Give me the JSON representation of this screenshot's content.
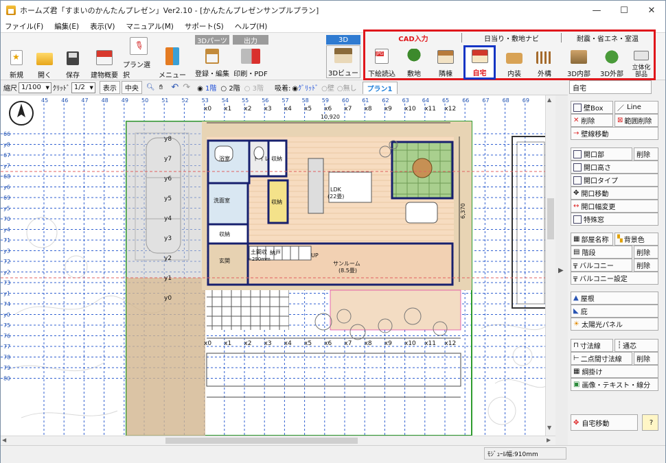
{
  "window": {
    "title": "ホームズ君「すまいのかんたんプレゼン」Ver2.10 - [かんたんプレゼンサンプルプラン]"
  },
  "menu": [
    "ファイル(F)",
    "編集(E)",
    "表示(V)",
    "マニュアル(M)",
    "サポート(S)",
    "ヘルプ(H)"
  ],
  "toolbar": {
    "new": "新規",
    "open": "開く",
    "save": "保存",
    "overview": "建物概要",
    "plan_select": "プラン選択",
    "menu": "メニュー",
    "parts3d_header": "3Dパーツ",
    "parts3d_btn": "登録・編集",
    "output_header": "出力",
    "print_btn": "印刷・PDF",
    "view3d_header": "3D",
    "view3d_btn": "3Dビュー"
  },
  "cad": {
    "group1": "CAD入力",
    "group2": "日当り・敷地ナビ",
    "group3": "耐震・省エネ・室温",
    "buttons": [
      "下絵読込",
      "敷地",
      "隣棟",
      "自宅",
      "内装",
      "外構",
      "3D内部",
      "3D外部",
      "立体化部品"
    ]
  },
  "options": {
    "scale_label": "縮尺",
    "scale_value": "1/100",
    "grid_label": "ｸﾘｯﾄﾞ",
    "grid_value": "1/2",
    "show": "表示",
    "center": "中央",
    "floor1": "1階",
    "floor2": "2階",
    "floor3": "3階",
    "snap_label": "吸着:",
    "snap_grid": "ｸﾞﾘｯﾄﾞ",
    "snap_wall": "壁",
    "snap_none": "無し",
    "plan_tab": "プラン1"
  },
  "panel": {
    "tab": "自宅",
    "buttons": [
      "壁Box",
      "Line",
      "削除",
      "範囲削除",
      "壁線移動",
      "開口部",
      "削除",
      "開口高さ",
      "開口タイプ",
      "開口移動",
      "開口幅変更",
      "特殊窓",
      "部屋名称",
      "背景色",
      "階段",
      "削除",
      "バルコニー",
      "削除",
      "バルコニー設定",
      "屋根",
      "庇",
      "太陽光パネル",
      "寸法線",
      "通芯",
      "二点間寸法線",
      "削除",
      "綱掛け",
      "画像・テキスト・線分",
      "自宅移動",
      "?"
    ]
  },
  "plan": {
    "top_ruler": [
      "45",
      "46",
      "47",
      "48",
      "49",
      "50",
      "51",
      "52",
      "53",
      "54",
      "55",
      "56",
      "57",
      "58",
      "59",
      "60",
      "61",
      "62",
      "63",
      "64",
      "65",
      "66",
      "67",
      "68",
      "69"
    ],
    "x_axes": [
      "x0",
      "x1",
      "x2",
      "x3",
      "x4",
      "x5",
      "x6",
      "x7",
      "x8",
      "x9",
      "x10",
      "x11",
      "x12"
    ],
    "y_axes": [
      "y8",
      "y7",
      "y6",
      "y5",
      "y4",
      "y3",
      "y2",
      "y1",
      "y0"
    ],
    "left_ruler": [
      "66",
      "y8",
      "67",
      "y7",
      "68",
      "y6",
      "69",
      "y5",
      "70",
      "y4",
      "71",
      "y3",
      "72",
      "y2",
      "73",
      "y1",
      "74",
      "y0",
      "75",
      "76",
      "77",
      "78",
      "79",
      "80"
    ],
    "dim_top": "10,920",
    "dim_right": "6,370",
    "rooms": [
      "浴室",
      "トイレ",
      "収納",
      "洗面室",
      "収納",
      "LDK",
      "(22畳)",
      "収納",
      "玄関",
      "土間収",
      "サンルーム",
      "(8.5畳)",
      "UP",
      "納戸"
    ],
    "stair_text": "~290mm"
  },
  "status": {
    "module": "ﾓｼﾞｭｰﾙ幅:910mm"
  }
}
